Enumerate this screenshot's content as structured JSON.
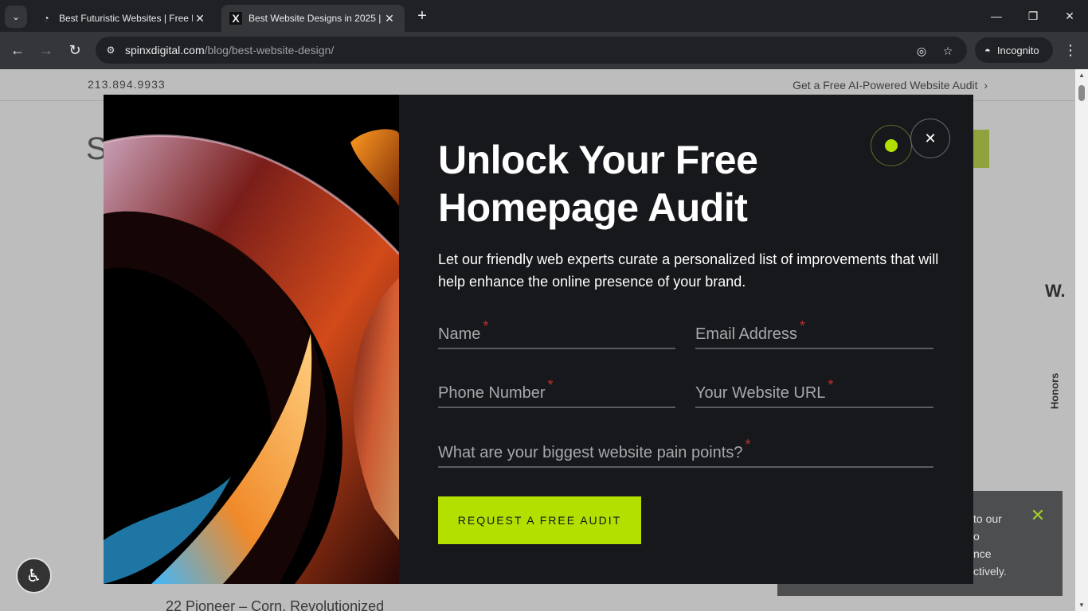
{
  "browser": {
    "tabs": [
      {
        "title": "Best Futuristic Websites | Free E",
        "active": false
      },
      {
        "title": "Best Website Designs in 2025 | E",
        "active": true
      }
    ],
    "url_host": "spinxdigital.com",
    "url_path": "/blog/best-website-design/",
    "incognito_label": "Incognito"
  },
  "page": {
    "phone": "213.894.9933",
    "audit_link": "Get a Free AI-Powered Website Audit",
    "heading_fragment": "S",
    "side_letter": "W.",
    "side_label": "Honors",
    "article_snippet": "22 Pioneer – Corn, Revolutionized",
    "cookie_lines": "to our\no\nnce\nctively."
  },
  "modal": {
    "title": "Unlock Your Free Homepage Audit",
    "description": "Let our friendly web experts curate a personalized list of improvements that will help enhance the online presence of your brand.",
    "fields": {
      "name": "Name",
      "email": "Email Address",
      "phone": "Phone Number",
      "website": "Your Website URL",
      "pain_points": "What are your biggest website pain points?"
    },
    "required_mark": "*",
    "submit_label": "REQUEST A FREE AUDIT"
  },
  "colors": {
    "accent": "#b4e000",
    "modal_bg": "#17181b",
    "required": "#b8342c"
  }
}
